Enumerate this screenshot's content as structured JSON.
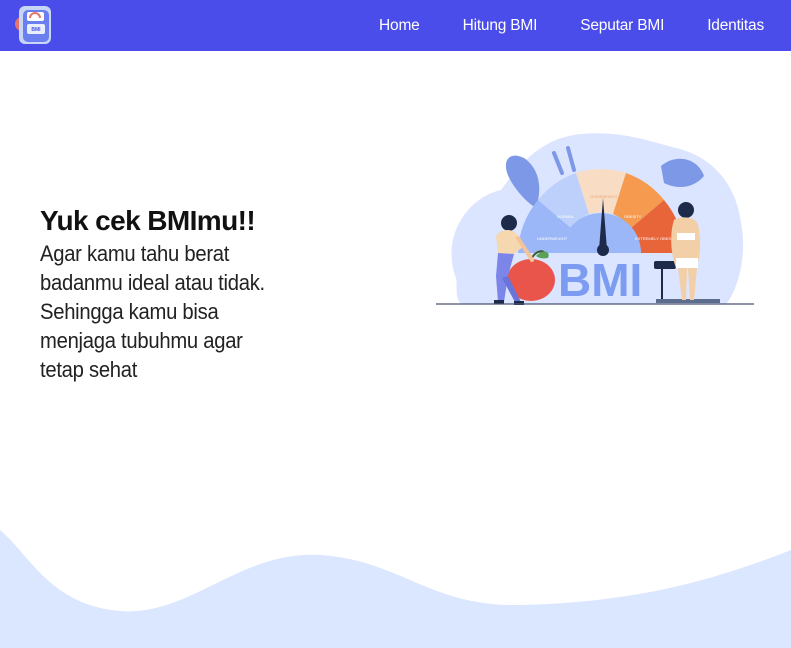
{
  "navbar": {
    "logo_icon": "bmi-scale-logo-icon",
    "links": [
      {
        "label": "Home"
      },
      {
        "label": "Hitung BMI"
      },
      {
        "label": "Seputar BMI"
      },
      {
        "label": "Identitas"
      }
    ]
  },
  "hero": {
    "title": "Yuk cek BMImu!!",
    "description": "Agar kamu tahu berat badanmu ideal atau tidak. Sehingga kamu bisa menjaga tubuhmu agar tetap sehat"
  },
  "illustration": {
    "bmi_text": "BMI",
    "gauge_labels": [
      "UNDERWEIGHT",
      "NORMAL",
      "OVERWEIGHT",
      "OBESITY",
      "EXTREMELY OBESITY"
    ]
  },
  "colors": {
    "nav_bg": "#4a4de9",
    "wave": "#dbe6ff",
    "accent_blue": "#7b9cf0"
  }
}
